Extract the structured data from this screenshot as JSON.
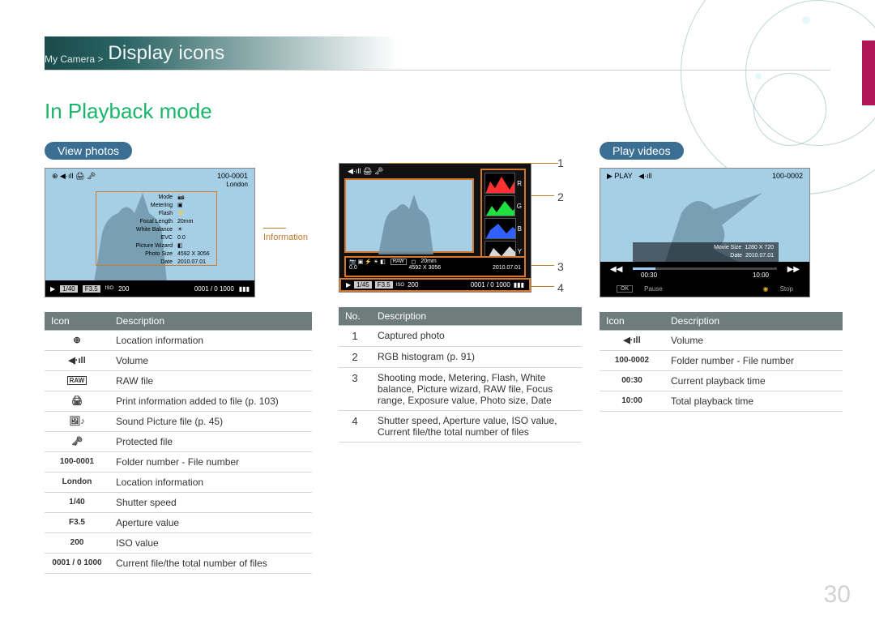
{
  "breadcrumb": {
    "parent": "My Camera >",
    "current": "Display icons"
  },
  "section_title": "In Playback mode",
  "view_photos": {
    "pill": "View photos",
    "info_label": "Information",
    "shot": {
      "file_no": "100-0001",
      "location": "London",
      "mode": "Mode",
      "metering": "Metering",
      "flash": "Flash",
      "focal_length_lbl": "Focal Length",
      "focal_length_val": "20mm",
      "white_balance": "White Balance",
      "evc_lbl": "EVC",
      "evc_val": "0.0",
      "picture_wizard": "Picture Wizard",
      "photo_size_lbl": "Photo Size",
      "photo_size_val": "4592 X 3056",
      "date_lbl": "Date",
      "date_val": "2010.07.01",
      "shutter": "1/40",
      "aperture": "F3.5",
      "iso_lbl": "ISO",
      "iso_val": "200",
      "counter": "0001 / 0 1000"
    },
    "table_headers": {
      "icon": "Icon",
      "desc": "Description"
    },
    "rows": [
      {
        "icon": "⊕",
        "icon_name": "location-icon",
        "desc": "Location information"
      },
      {
        "icon": "◀·ıll",
        "icon_name": "volume-icon",
        "desc": "Volume"
      },
      {
        "icon": "RAW",
        "icon_name": "raw-icon",
        "desc": "RAW file",
        "boxed": true
      },
      {
        "icon": "🖨",
        "icon_name": "print-icon",
        "desc": "Print information added to file (p. 103)"
      },
      {
        "icon": "🖼♪",
        "icon_name": "sound-picture-icon",
        "desc": "Sound Picture file (p. 45)"
      },
      {
        "icon": "🗝",
        "icon_name": "protected-icon",
        "desc": "Protected file"
      },
      {
        "icon": "100-0001",
        "icon_name": "folder-file-text",
        "desc": "Folder number - File number",
        "textIcon": true
      },
      {
        "icon": "London",
        "icon_name": "location-text",
        "desc": "Location information",
        "textIcon": true
      },
      {
        "icon": "1/40",
        "icon_name": "shutter-text",
        "desc": "Shutter speed",
        "textIcon": true
      },
      {
        "icon": "F3.5",
        "icon_name": "aperture-text",
        "desc": "Aperture value",
        "textIcon": true
      },
      {
        "icon": "200",
        "icon_name": "iso-text",
        "desc": "ISO value",
        "textIcon": true
      },
      {
        "icon": "0001 / 0 1000",
        "icon_name": "counter-text",
        "desc": "Current file/the total number of files",
        "textIcon": true
      }
    ]
  },
  "hist_panel": {
    "callouts": [
      "1",
      "2",
      "3",
      "4"
    ],
    "letters": [
      "R",
      "G",
      "B",
      "Y"
    ],
    "shutter": "1/45",
    "aperture": "F3.5",
    "iso_lbl": "ISO",
    "iso_val": "200",
    "counter": "0001 / 0 1000",
    "focal": "20mm",
    "evc": "0.0",
    "size": "4592 X 3056",
    "date": "2010.07.01",
    "table_headers": {
      "no": "No.",
      "desc": "Description"
    },
    "rows": [
      {
        "no": "1",
        "desc": "Captured photo"
      },
      {
        "no": "2",
        "desc": "RGB histogram (p. 91)"
      },
      {
        "no": "3",
        "desc": "Shooting mode, Metering, Flash, White balance, Picture wizard, RAW file, Focus range, Exposure value, Photo size, Date"
      },
      {
        "no": "4",
        "desc": "Shutter speed, Aperture value, ISO value, Current file/the total number of files"
      }
    ]
  },
  "play_videos": {
    "pill": "Play videos",
    "shot": {
      "play_lbl": "PLAY",
      "file_no": "100-0002",
      "movie_size_lbl": "Movie Size",
      "movie_size_val": "1280 X 720",
      "date_lbl": "Date",
      "date_val": "2010.07.01",
      "cur_time": "00:30",
      "tot_time": "10:00",
      "pause_hint": "Pause",
      "stop_hint": "Stop",
      "ok": "OK"
    },
    "table_headers": {
      "icon": "Icon",
      "desc": "Description"
    },
    "rows": [
      {
        "icon": "◀·ıll",
        "icon_name": "volume-icon",
        "desc": "Volume"
      },
      {
        "icon": "100-0002",
        "icon_name": "folder-file-text",
        "desc": "Folder number - File number",
        "textIcon": true
      },
      {
        "icon": "00:30",
        "icon_name": "current-time-text",
        "desc": "Current playback time",
        "textIcon": true
      },
      {
        "icon": "10:00",
        "icon_name": "total-time-text",
        "desc": "Total playback time",
        "textIcon": true
      }
    ]
  },
  "page_number": "30"
}
